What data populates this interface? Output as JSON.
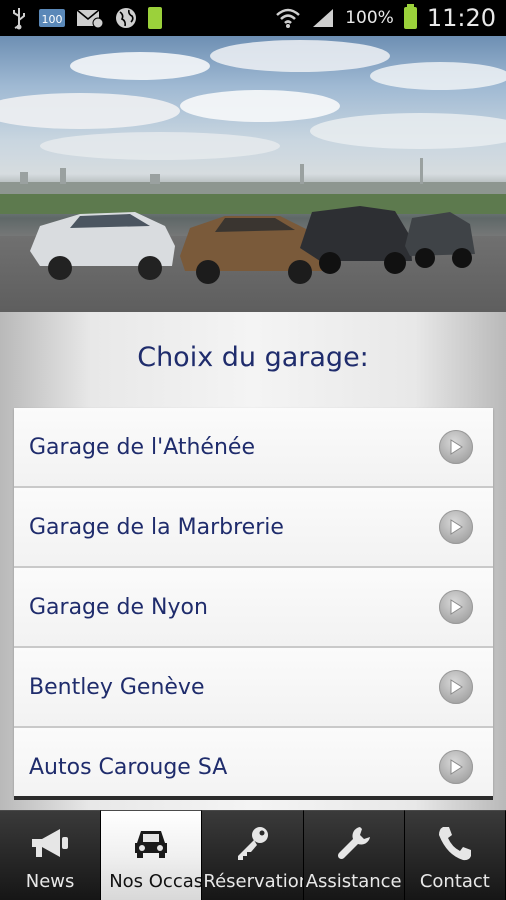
{
  "status_bar": {
    "battery_percent": "100%",
    "time": "11:20",
    "icons": [
      "usb-icon",
      "sim-100-icon",
      "mail-icon",
      "globe-icon",
      "battery-small-icon",
      "wifi-icon",
      "signal-icon",
      "battery-icon"
    ]
  },
  "hero": {
    "image": "cars-on-road-photo"
  },
  "content": {
    "title": "Choix du garage:",
    "garages": [
      {
        "label": "Garage de l'Athénée"
      },
      {
        "label": "Garage de la Marbrerie"
      },
      {
        "label": "Garage de Nyon"
      },
      {
        "label": "Bentley Genève"
      },
      {
        "label": "Autos Carouge SA"
      }
    ]
  },
  "tabs": [
    {
      "label": "News",
      "icon": "megaphone-icon",
      "active": false
    },
    {
      "label": "Nos Occasions",
      "icon": "car-icon",
      "active": true
    },
    {
      "label": "Réservations",
      "icon": "key-icon",
      "active": false
    },
    {
      "label": "Assistance",
      "icon": "wrench-icon",
      "active": false
    },
    {
      "label": "Contact",
      "icon": "phone-icon",
      "active": false
    }
  ],
  "colors": {
    "title": "#1f2c6c",
    "battery": "#9bd13b",
    "tab_bar": "#000000"
  }
}
